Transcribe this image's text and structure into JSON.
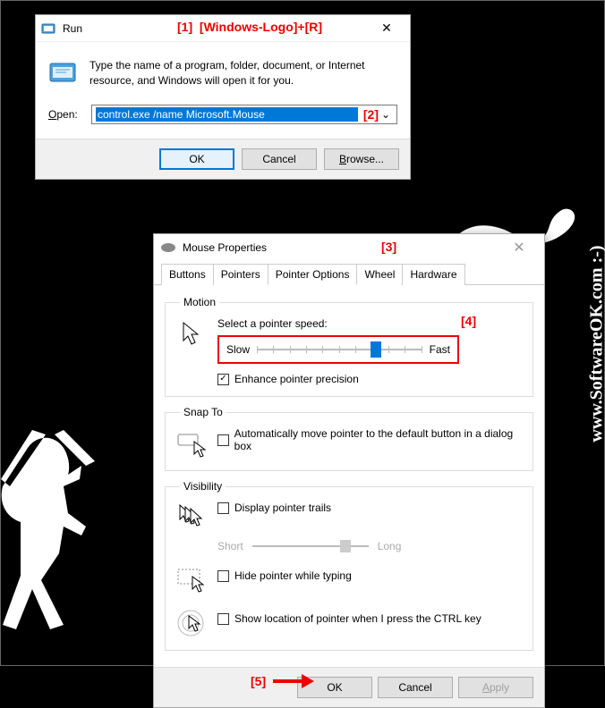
{
  "website": "www.SoftwareOK.com :-)",
  "annotations": {
    "a1": "[1]",
    "a1_hint": "[Windows-Logo]+[R]",
    "a2": "[2]",
    "a3": "[3]",
    "a4": "[4]",
    "a5": "[5]"
  },
  "run": {
    "title": "Run",
    "description": "Type the name of a program, folder, document, or Internet resource, and Windows will open it for you.",
    "open_label": "Open:",
    "command": "control.exe /name Microsoft.Mouse",
    "buttons": {
      "ok": "OK",
      "cancel": "Cancel",
      "browse": "Browse..."
    }
  },
  "mouse": {
    "title": "Mouse Properties",
    "tabs": [
      "Buttons",
      "Pointers",
      "Pointer Options",
      "Wheel",
      "Hardware"
    ],
    "active_tab": 2,
    "motion": {
      "legend": "Motion",
      "speed_label": "Select a pointer speed:",
      "slow": "Slow",
      "fast": "Fast",
      "speed_value_percent": 72,
      "enhance": {
        "label": "Enhance pointer precision",
        "checked": true
      }
    },
    "snapto": {
      "legend": "Snap To",
      "auto": {
        "label": "Automatically move pointer to the default button in a dialog box",
        "checked": false
      }
    },
    "visibility": {
      "legend": "Visibility",
      "trails": {
        "label": "Display pointer trails",
        "checked": false,
        "short": "Short",
        "long": "Long"
      },
      "hide": {
        "label": "Hide pointer while typing",
        "checked": false
      },
      "ctrl": {
        "label": "Show location of pointer when I press the CTRL key",
        "checked": false
      }
    },
    "buttons": {
      "ok": "OK",
      "cancel": "Cancel",
      "apply": "Apply"
    }
  }
}
